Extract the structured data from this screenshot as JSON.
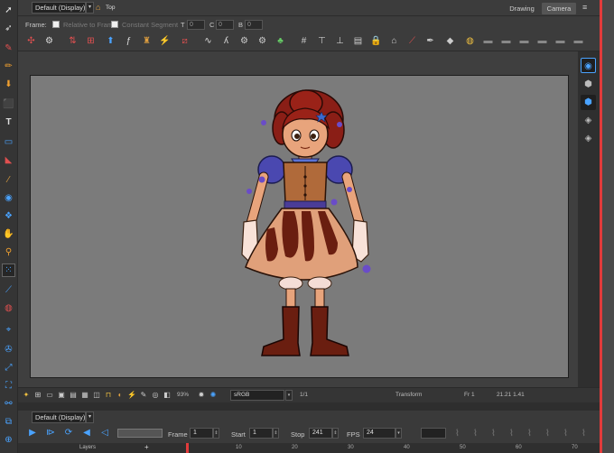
{
  "top_bar": {
    "view_dropdown": "Default (Display)",
    "top_label": "Top",
    "tabs": {
      "drawing": "Drawing",
      "camera": "Camera"
    }
  },
  "frame_row": {
    "frame_label": "Frame:",
    "relative_label": "Relative to Frame",
    "constant_label": "Constant Segment",
    "t_label": "T",
    "t_value": "0",
    "c_label": "C",
    "c_value": "0",
    "b_label": "B",
    "b_value": "0"
  },
  "status_bar": {
    "zoom": "93%",
    "color_space": "sRGB",
    "ratio": "1/1",
    "tool_name": "Transform",
    "frame": "Fr 1",
    "coords": "21.21 1.41"
  },
  "timeline": {
    "view_dropdown": "Default (Display)",
    "frame_label": "Frame",
    "frame_value": "1",
    "start_label": "Start",
    "start_value": "1",
    "stop_label": "Stop",
    "stop_value": "241",
    "fps_label": "FPS",
    "fps_value": "24",
    "layers_label": "Layers",
    "ruler_ticks": [
      "10",
      "20",
      "30",
      "40",
      "50",
      "60",
      "70"
    ]
  },
  "colors": {
    "accent_blue": "#4aa3ff",
    "stage_gray": "#7b7b7b",
    "playhead_red": "#e23b3b"
  }
}
